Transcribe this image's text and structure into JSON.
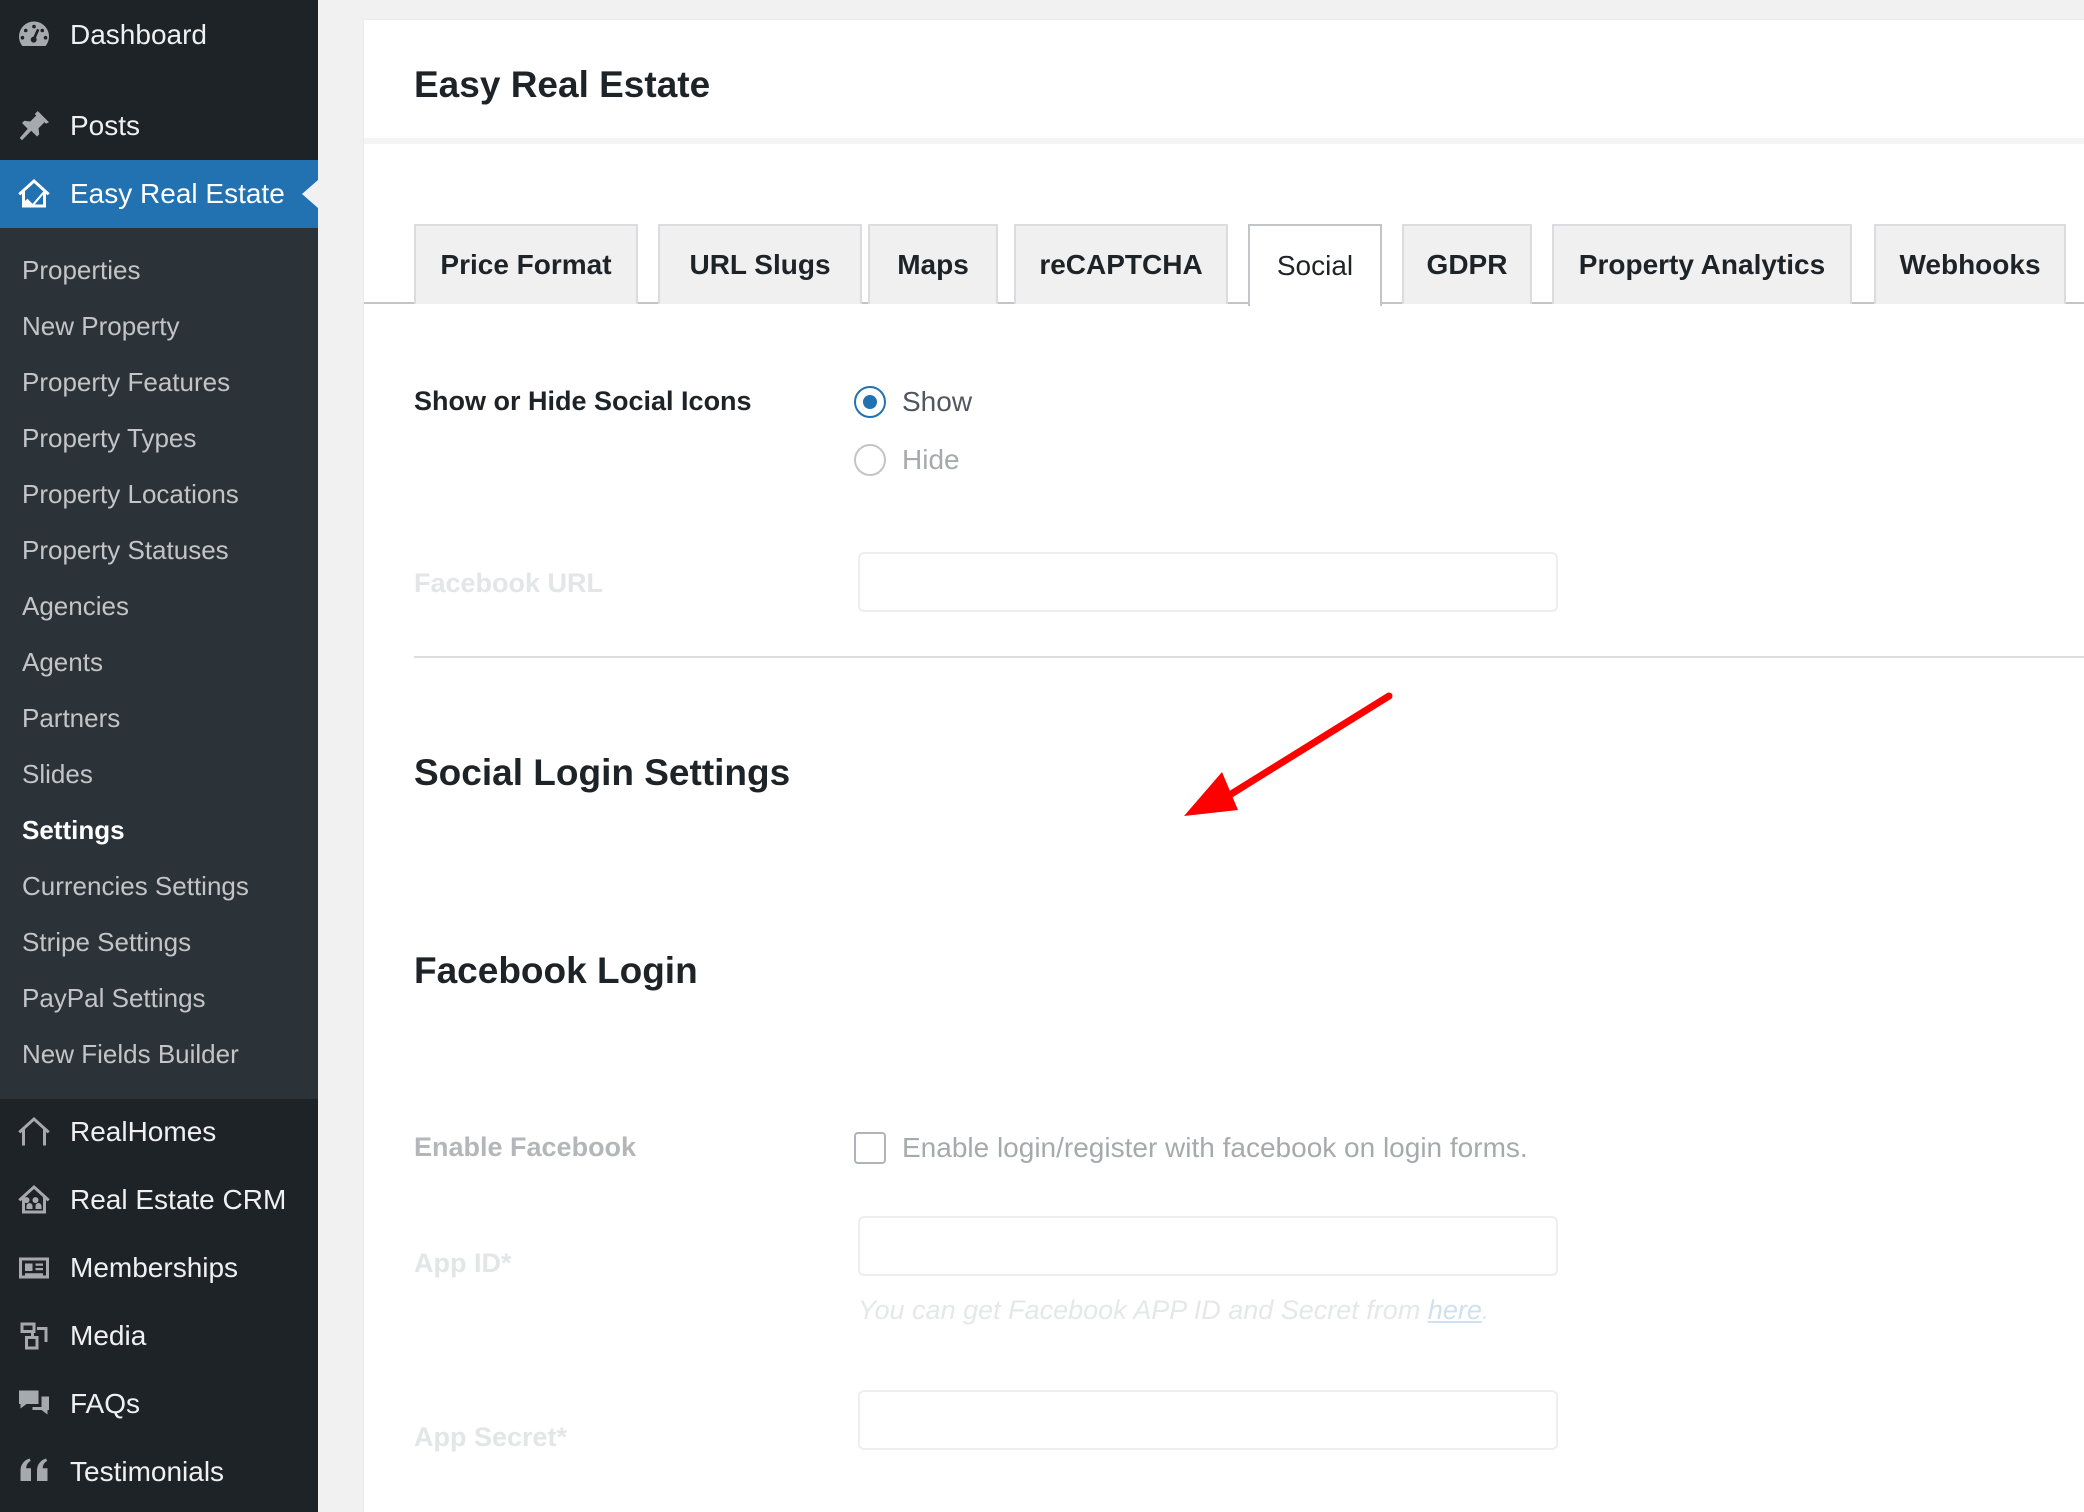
{
  "sidebar": {
    "top_items": [
      {
        "label": "Dashboard",
        "icon": "dashboard-icon"
      },
      {
        "label": "Posts",
        "icon": "pin-icon"
      },
      {
        "label": "Easy Real Estate",
        "icon": "house-icon"
      }
    ],
    "submenu": [
      "Properties",
      "New Property",
      "Property Features",
      "Property Types",
      "Property Locations",
      "Property Statuses",
      "Agencies",
      "Agents",
      "Partners",
      "Slides",
      "Settings",
      "Currencies Settings",
      "Stripe Settings",
      "PayPal Settings",
      "New Fields Builder"
    ],
    "current_submenu": "Settings",
    "bottom_items": [
      {
        "label": "RealHomes",
        "icon": "house-outline-icon"
      },
      {
        "label": "Real Estate CRM",
        "icon": "crm-icon"
      },
      {
        "label": "Memberships",
        "icon": "id-card-icon"
      },
      {
        "label": "Media",
        "icon": "media-icon"
      },
      {
        "label": "FAQs",
        "icon": "chat-bubbles-icon"
      },
      {
        "label": "Testimonials",
        "icon": "quote-icon"
      }
    ]
  },
  "page": {
    "title": "Easy Real Estate"
  },
  "tabs": [
    "Price Format",
    "URL Slugs",
    "Maps",
    "reCAPTCHA",
    "Social",
    "GDPR",
    "Property Analytics",
    "Webhooks"
  ],
  "active_tab": "Social",
  "social": {
    "show_hide_label": "Show or Hide Social Icons",
    "options": [
      "Show",
      "Hide"
    ],
    "selected": "Show",
    "facebook_url_label": "Facebook URL",
    "facebook_url_value": ""
  },
  "social_login": {
    "title": "Social Login Settings",
    "facebook_title": "Facebook Login",
    "enable_label": "Enable Facebook",
    "enable_checkbox_label": "Enable login/register with facebook on login forms.",
    "enabled": false,
    "app_id_label": "App ID*",
    "app_id_value": "",
    "help_text": "You can get Facebook APP ID and Secret from ",
    "help_link": "here",
    "help_suffix": ".",
    "app_secret_label": "App Secret*",
    "app_secret_value": ""
  },
  "annotation": {
    "arrow_color": "#ff0000"
  },
  "colors": {
    "sidebar_bg": "#1d2327",
    "submenu_bg": "#2c3338",
    "accent": "#2271b1"
  }
}
